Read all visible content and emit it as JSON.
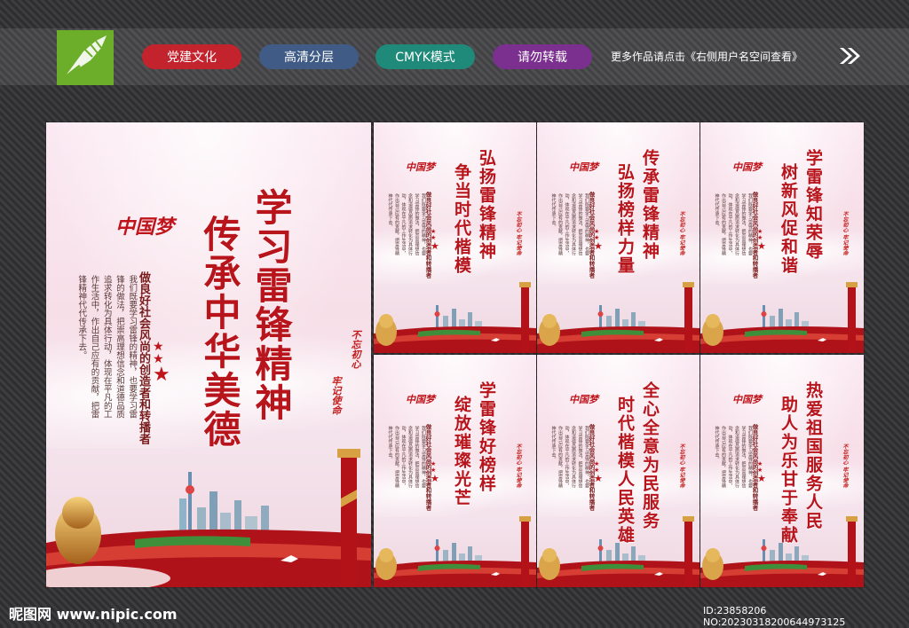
{
  "header": {
    "buttons": [
      "党建文化",
      "高清分层",
      "CMYK模式",
      "请勿转载"
    ],
    "more_text": "更多作品请点击《右侧用户名空间查看》"
  },
  "main_poster": {
    "title_right": "学习雷锋精神",
    "title_left": "传承中华美德",
    "subtitle": "做良好社会风尚的创造者和转播者",
    "body": "我们既要学习雷锋的精神，也要学习雷锋的做法，把崇高理想信念和道德品质追求转化为具体行动，体现在平凡的工作生活中，作出自己应有的贡献，把雷锋精神代代传承下去。",
    "seal_left": "不忘初心",
    "seal_right": "牢记使命",
    "brand": "中国梦"
  },
  "small_posters": [
    {
      "line1": "弘扬雷锋精神",
      "line2": "争当时代楷模"
    },
    {
      "line1": "传承雷锋精神",
      "line2": "弘扬榜样力量"
    },
    {
      "line1": "学雷锋知荣辱",
      "line2": "树新风促和谐"
    },
    {
      "line1": "学雷锋好榜样",
      "line2": "绽放璀璨光芒"
    },
    {
      "line1": "全心全意为民服务",
      "line2": "时代楷模人民英雄"
    },
    {
      "line1": "热爱祖国服务人民",
      "line2": "助人为乐甘于奉献"
    }
  ],
  "small_common": {
    "subtitle": "做良好社会风尚的创造者和转播者",
    "body": "我们既要学习雷锋的精神，也要学习雷锋的做法，把崇高理想信念和道德品质追求转化为具体行动，体现在平凡的工作生活中，作出自己应有的贡献，把雷锋精神代代传承下去。",
    "seal": "不忘初心 牢记使命",
    "brand": "中国梦"
  },
  "footer": {
    "site": "昵图网 www.nipic.com",
    "id_text": "ID:23858206 NO:20230318200644973125"
  },
  "colors": {
    "red": "#b8141c",
    "pink_bg": "#fbe9f2"
  }
}
